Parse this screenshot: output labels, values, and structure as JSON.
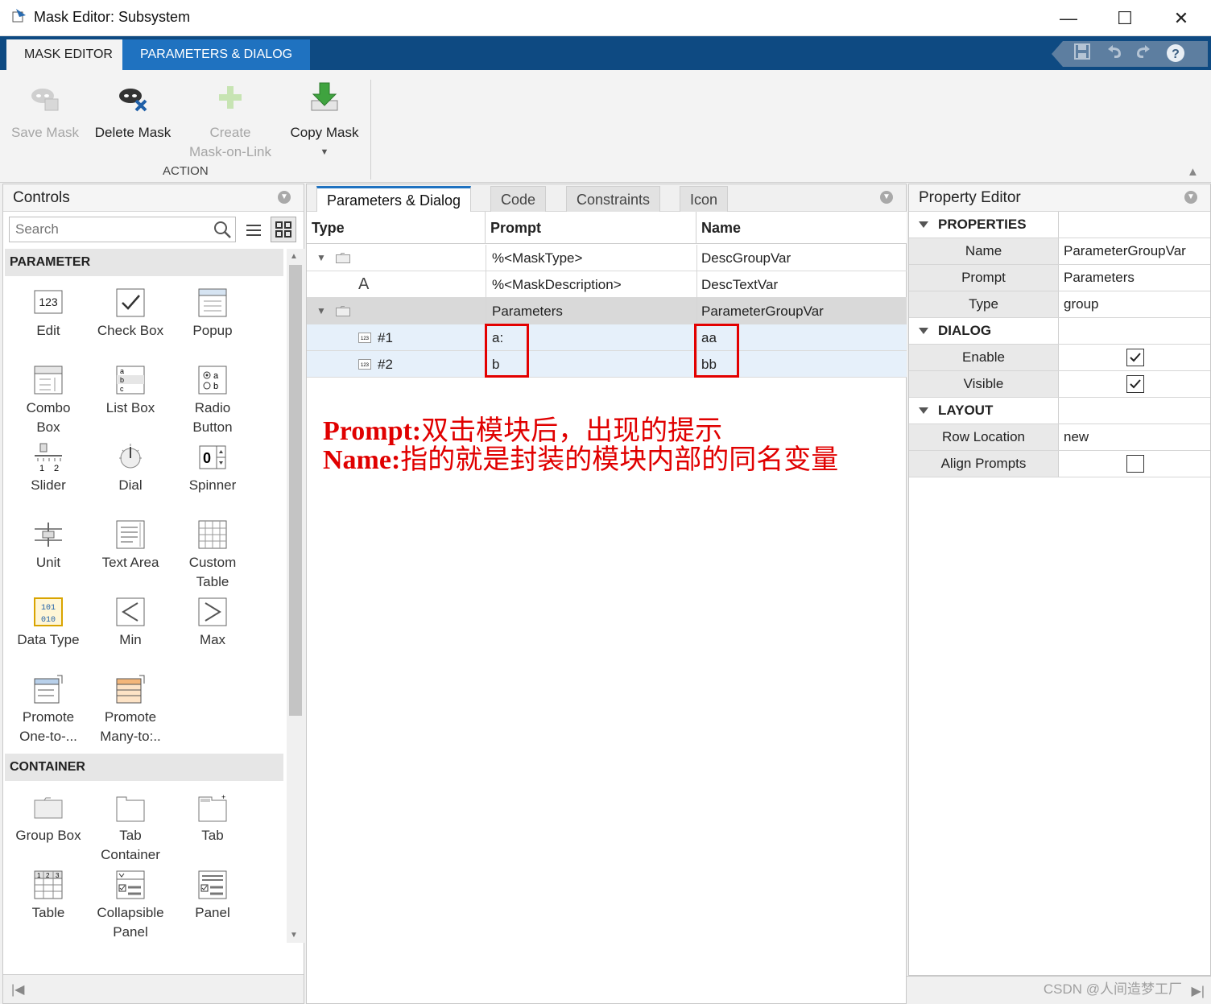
{
  "window": {
    "title": "Mask Editor: Subsystem",
    "controls": [
      "—",
      "☐",
      "✕"
    ]
  },
  "ribbon": {
    "tabs": [
      "MASK EDITOR",
      "PARAMETERS & DIALOG"
    ],
    "active_tab": "MASK EDITOR",
    "quick_access": [
      "save-icon",
      "undo-icon",
      "redo-icon",
      "help-icon"
    ],
    "buttons": [
      {
        "label": "Save Mask",
        "enabled": false
      },
      {
        "label": "Delete Mask",
        "enabled": true
      },
      {
        "label": "Create\nMask-on-Link",
        "line1": "Create",
        "line2": "Mask-on-Link",
        "enabled": false
      },
      {
        "label": "Copy Mask",
        "enabled": true,
        "has_dropdown": true
      }
    ],
    "group_label": "ACTION"
  },
  "controls_pane": {
    "title": "Controls",
    "search_placeholder": "Search",
    "sections": [
      {
        "title": "PARAMETER",
        "items": [
          [
            "Edit"
          ],
          [
            "Check Box"
          ],
          [
            "Popup"
          ],
          [
            "Combo",
            "Box"
          ],
          [
            "List Box"
          ],
          [
            "Radio",
            "Button"
          ],
          [
            "Slider"
          ],
          [
            "Dial"
          ],
          [
            "Spinner"
          ],
          [
            "Unit"
          ],
          [
            "Text Area"
          ],
          [
            "Custom",
            "Table"
          ],
          [
            "Data Type"
          ],
          [
            "Min"
          ],
          [
            "Max"
          ],
          [
            "Promote",
            "One-to-..."
          ],
          [
            "Promote",
            "Many-to:.."
          ]
        ]
      },
      {
        "title": "CONTAINER",
        "items": [
          [
            "Group Box"
          ],
          [
            "Tab",
            "Container"
          ],
          [
            "Tab"
          ],
          [
            "Table"
          ],
          [
            "Collapsible",
            "Panel"
          ],
          [
            "Panel"
          ]
        ]
      }
    ]
  },
  "center_pane": {
    "tabs": [
      "Parameters & Dialog",
      "Code",
      "Constraints",
      "Icon"
    ],
    "active_tab": "Parameters & Dialog",
    "columns": [
      "Type",
      "Prompt",
      "Name"
    ],
    "rows": [
      {
        "type": "",
        "prompt": "%<MaskType>",
        "name": "DescGroupVar",
        "expander": true
      },
      {
        "type": "A",
        "prompt": "%<MaskDescription>",
        "name": "DescTextVar",
        "expander": false
      },
      {
        "type": "",
        "prompt": "Parameters",
        "name": "ParameterGroupVar",
        "expander": true,
        "selected": true
      },
      {
        "type": "#1",
        "prompt": "a:",
        "name": "aa",
        "highlight": true
      },
      {
        "type": "#2",
        "prompt": "b",
        "name": "bb",
        "highlight": true
      }
    ],
    "annotations": [
      {
        "label": "Prompt:",
        "text": "双击模块后，出现的提示"
      },
      {
        "label": "Name:",
        "text": "指的就是封装的模块内部的同名变量"
      }
    ]
  },
  "property_editor": {
    "title": "Property Editor",
    "sections": [
      {
        "title": "PROPERTIES",
        "rows": [
          {
            "key": "Name",
            "value": "ParameterGroupVar"
          },
          {
            "key": "Prompt",
            "value": "Parameters"
          },
          {
            "key": "Type",
            "value": "group"
          }
        ]
      },
      {
        "title": "DIALOG",
        "rows": [
          {
            "key": "Enable",
            "checked": true
          },
          {
            "key": "Visible",
            "checked": true
          }
        ]
      },
      {
        "title": "LAYOUT",
        "rows": [
          {
            "key": "Row Location",
            "value": "new"
          },
          {
            "key": "Align Prompts",
            "checked": false
          }
        ]
      }
    ]
  },
  "watermark": "CSDN @人间造梦工厂",
  "colors": {
    "ribbon_tab_bar": "#0e4a82",
    "annotation": "#e00000",
    "active_tab_accent": "#1f72c0"
  }
}
